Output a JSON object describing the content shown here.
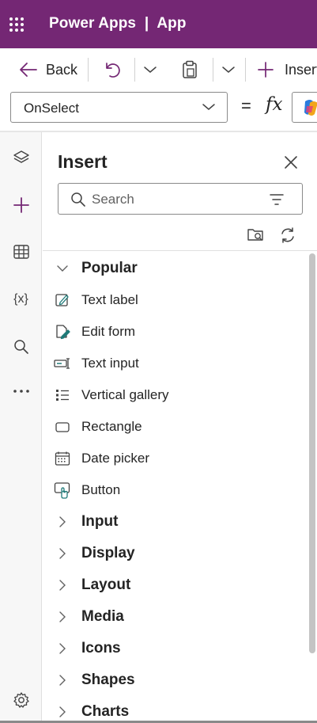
{
  "app": {
    "title": "Power Apps  |  App"
  },
  "colors": {
    "brand": "#742774",
    "accent": "#742774",
    "teal": "#1f7a78"
  },
  "commandbar": {
    "back_label": "Back",
    "insert_label": "Insert"
  },
  "formula": {
    "property": "OnSelect",
    "equals": "=",
    "fx": "fx"
  },
  "rail": {
    "items": [
      {
        "name": "tree-view",
        "icon": "layers-icon"
      },
      {
        "name": "insert",
        "icon": "plus-icon"
      },
      {
        "name": "data",
        "icon": "table-icon"
      },
      {
        "name": "variables",
        "icon": "variables-icon",
        "text": "{x}"
      },
      {
        "name": "search",
        "icon": "search-icon"
      },
      {
        "name": "more",
        "icon": "more-icon"
      },
      {
        "name": "settings",
        "icon": "gear-icon"
      }
    ]
  },
  "insert_pane": {
    "title": "Insert",
    "search_placeholder": "Search",
    "categories": [
      {
        "label": "Popular",
        "expanded": true
      },
      {
        "label": "Input",
        "expanded": false
      },
      {
        "label": "Display",
        "expanded": false
      },
      {
        "label": "Layout",
        "expanded": false
      },
      {
        "label": "Media",
        "expanded": false
      },
      {
        "label": "Icons",
        "expanded": false
      },
      {
        "label": "Shapes",
        "expanded": false
      },
      {
        "label": "Charts",
        "expanded": false
      }
    ],
    "popular_items": [
      {
        "label": "Text label",
        "icon": "text-label-icon"
      },
      {
        "label": "Edit form",
        "icon": "edit-form-icon"
      },
      {
        "label": "Text input",
        "icon": "text-input-icon"
      },
      {
        "label": "Vertical gallery",
        "icon": "vertical-gallery-icon"
      },
      {
        "label": "Rectangle",
        "icon": "rectangle-icon"
      },
      {
        "label": "Date picker",
        "icon": "date-picker-icon"
      },
      {
        "label": "Button",
        "icon": "button-icon"
      }
    ]
  }
}
